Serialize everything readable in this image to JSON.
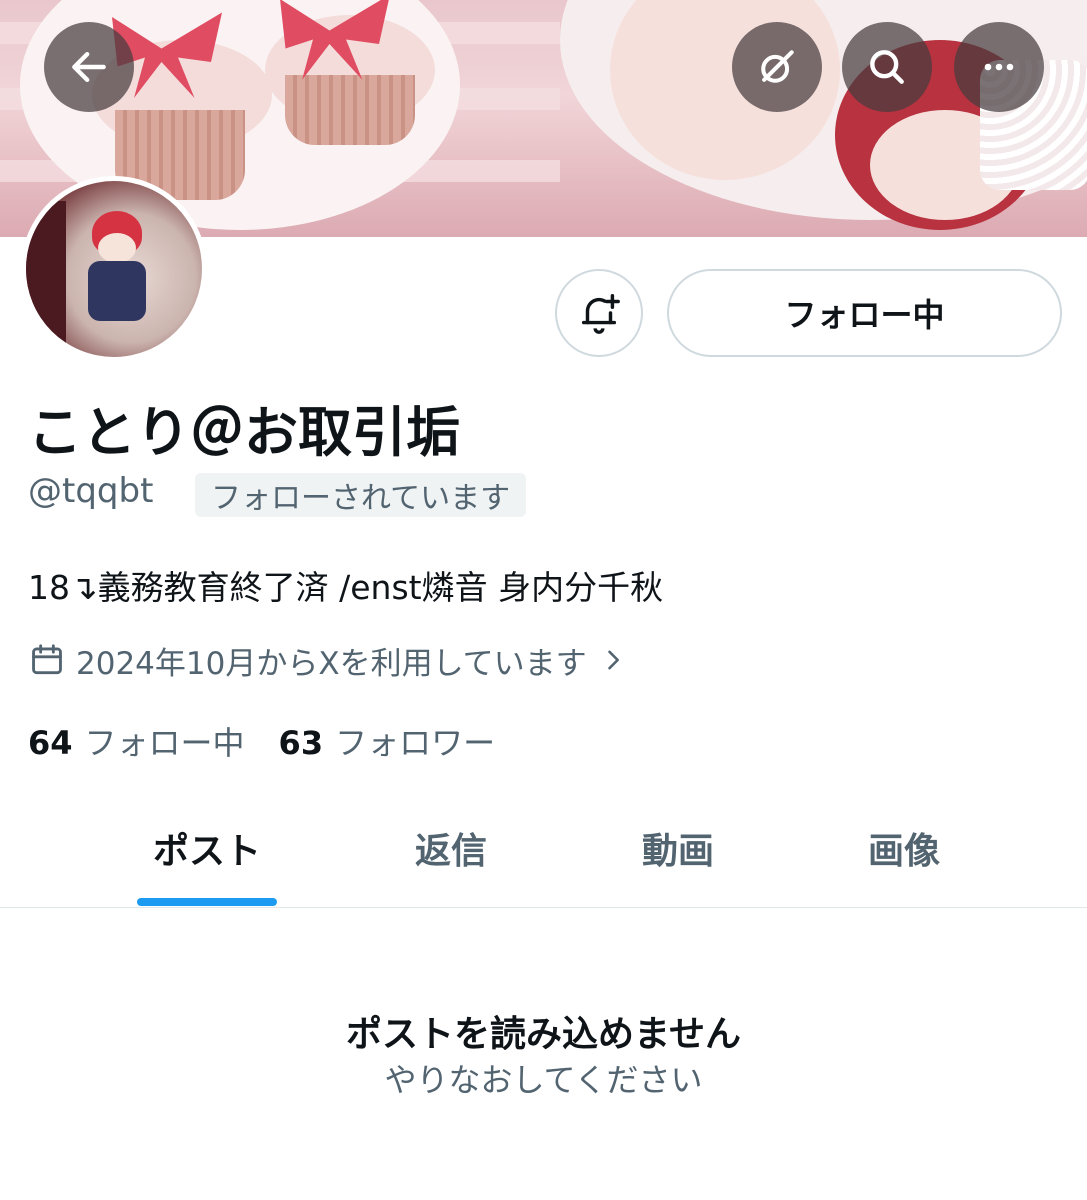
{
  "header": {
    "back_icon": "arrow-left-icon",
    "grok_icon": "grok-icon",
    "search_icon": "search-icon",
    "more_icon": "more-icon"
  },
  "profile": {
    "display_name": "ことり＠お取引垢",
    "handle": "@tqqbt",
    "follows_you_badge": "フォローされています",
    "bio": "18↴義務教育終了済 /enst燐音 身内分千秋",
    "joined": "2024年10月からXを利用しています",
    "following_count": "64",
    "following_label": "フォロー中",
    "followers_count": "63",
    "followers_label": "フォロワー"
  },
  "actions": {
    "follow_state_label": "フォロー中",
    "notify_icon": "bell-plus-icon"
  },
  "tabs": [
    {
      "label": "ポスト",
      "active": true
    },
    {
      "label": "返信",
      "active": false
    },
    {
      "label": "動画",
      "active": false
    },
    {
      "label": "画像",
      "active": false
    }
  ],
  "empty_state": {
    "title": "ポストを読み込めません",
    "subtitle": "やりなおしてください"
  },
  "colors": {
    "accent": "#1d9bf0",
    "text_primary": "#0f1419",
    "text_secondary": "#536471",
    "border": "#cfd9de"
  }
}
